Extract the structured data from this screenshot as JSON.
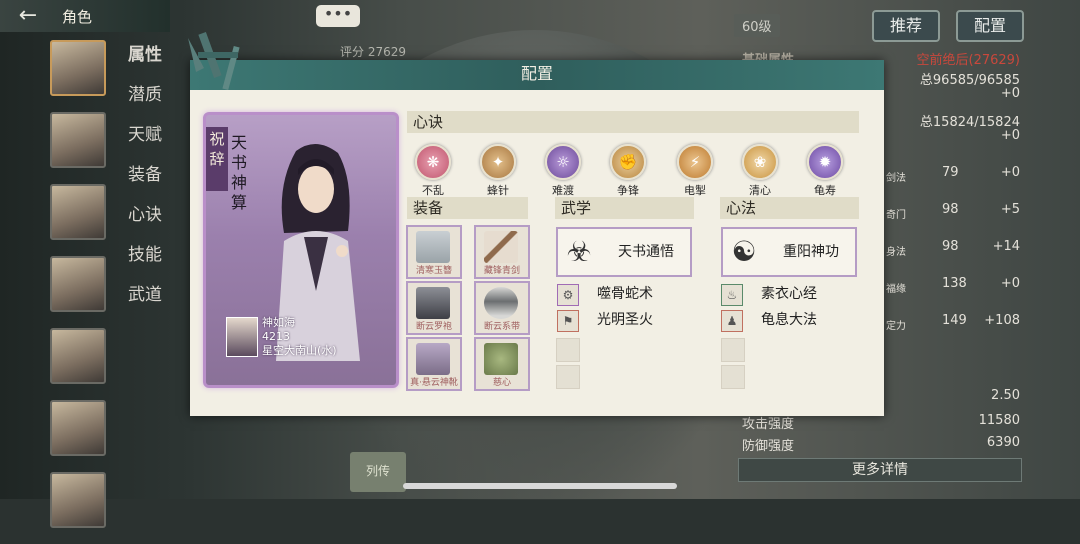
{
  "screen": {
    "title": "角色",
    "nav": [
      "属性",
      "潜质",
      "天赋",
      "装备",
      "心诀",
      "技能",
      "武道"
    ],
    "level_badge": "60级",
    "buttons": {
      "recommend": "推荐",
      "config": "配置"
    },
    "score_label": "评分",
    "score_value": "27629",
    "right_stats": {
      "header_left": "基础属性",
      "header_right": "空前绝后(27629)",
      "rows": [
        {
          "left": "",
          "right": "总96585/96585"
        },
        {
          "left": "",
          "right": "+0"
        },
        {
          "left": "",
          "right": "总15824/15824"
        },
        {
          "left": "",
          "right": "+0"
        },
        {
          "left": "剑法",
          "mid": "79",
          "right": "+0"
        },
        {
          "left": "奇门",
          "mid": "98",
          "right": "+5"
        },
        {
          "left": "身法",
          "mid": "98",
          "right": "+14"
        },
        {
          "left": "福缘",
          "mid": "138",
          "right": "+0"
        },
        {
          "left": "定力",
          "mid": "149",
          "right": "+108"
        }
      ],
      "bottom": [
        {
          "label": "",
          "value": "2.50"
        },
        {
          "label": "攻击强度",
          "value": "11580"
        },
        {
          "label": "防御强度",
          "value": "6390"
        }
      ]
    },
    "more_button": "更多详情",
    "seal_text": "列传"
  },
  "modal": {
    "title": "配置",
    "card": {
      "tag": "祝辞",
      "name": "天书神算",
      "owner_name": "神如海",
      "owner_id": "4213",
      "owner_server": "星空大南山(水)",
      "border_color": "#b98fc9"
    },
    "hearts_section": "心诀",
    "hearts": [
      {
        "label": "不乱",
        "color": "#c0556e",
        "icon": "swirl-icon"
      },
      {
        "label": "蜂针",
        "color": "#a7763f",
        "icon": "needle-icon"
      },
      {
        "label": "难渡",
        "color": "#6c4a9a",
        "icon": "ghost-icon"
      },
      {
        "label": "争锋",
        "color": "#b8843c",
        "icon": "fist-icon"
      },
      {
        "label": "电掣",
        "color": "#bd7a2e",
        "icon": "lightning-icon"
      },
      {
        "label": "清心",
        "color": "#c9933d",
        "icon": "lotus-icon"
      },
      {
        "label": "龟寿",
        "color": "#6d4aa3",
        "icon": "mandala-icon"
      }
    ],
    "equip_section": "装备",
    "equipment": [
      {
        "name": "清寒玉簪",
        "color": "#9aa3a8"
      },
      {
        "name": "藏锋青剑",
        "color": "#8f6a4c"
      },
      {
        "name": "断云罗袍",
        "color": "#5e5f66"
      },
      {
        "name": "断云系带",
        "color": "#6b6e70"
      },
      {
        "name": "真·悬云神靴",
        "color": "#7b6d88"
      },
      {
        "name": "慈心",
        "color": "#6a7a4a"
      }
    ],
    "martial_section": "武学",
    "martial_main": "天书通悟",
    "martial_list": [
      "噬骨蛇术",
      "光明圣火"
    ],
    "mind_section": "心法",
    "mind_main": "重阳神功",
    "mind_list": [
      "素衣心经",
      "龟息大法"
    ]
  }
}
